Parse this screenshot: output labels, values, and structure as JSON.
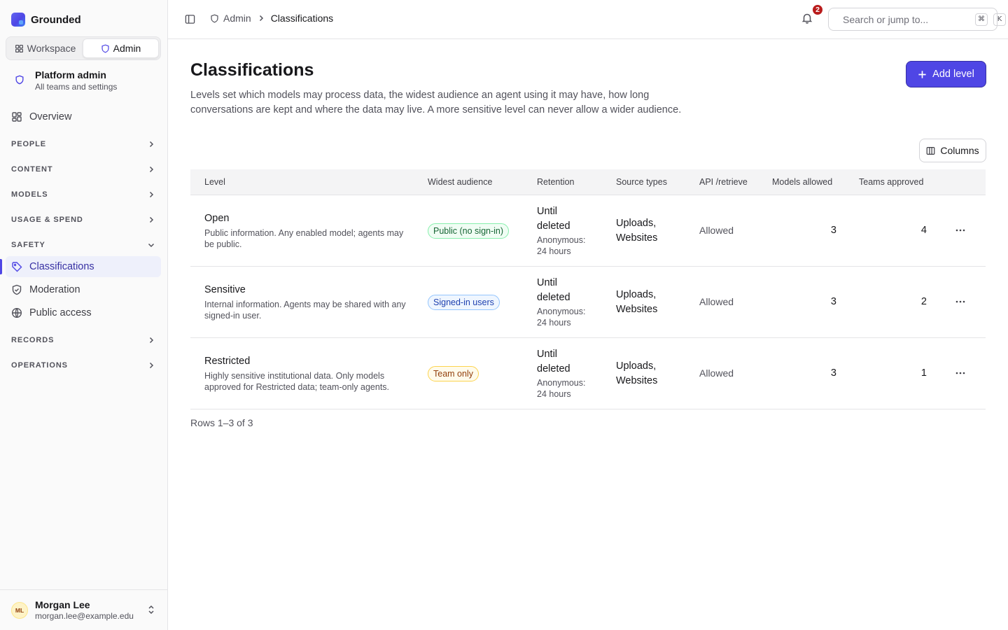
{
  "brand": {
    "name": "Grounded"
  },
  "switcher": {
    "workspace": "Workspace",
    "admin": "Admin"
  },
  "context": {
    "title": "Platform admin",
    "subtitle": "All teams and settings"
  },
  "nav": {
    "overview": "Overview",
    "people": "PEOPLE",
    "content": "CONTENT",
    "models": "MODELS",
    "usage": "USAGE & SPEND",
    "safety": "SAFETY",
    "classifications": "Classifications",
    "moderation": "Moderation",
    "public_access": "Public access",
    "records": "RECORDS",
    "operations": "OPERATIONS"
  },
  "user": {
    "initials": "ML",
    "name": "Morgan Lee",
    "email": "morgan.lee@example.edu"
  },
  "topbar": {
    "crumb_admin": "Admin",
    "crumb_current": "Classifications",
    "notifications": "2",
    "search_placeholder": "Search or jump to...",
    "kbd_cmd": "⌘",
    "kbd_k": "K"
  },
  "page": {
    "title": "Classifications",
    "description": "Levels set which models may process data, the widest audience an agent using it may have, how long conversations are kept and where the data may live. A more sensitive level can never allow a wider audience.",
    "add_label": "Add level",
    "columns_label": "Columns",
    "rows_count": "Rows 1–3 of 3"
  },
  "table": {
    "headers": {
      "level": "Level",
      "audience": "Widest audience",
      "retention": "Retention",
      "source": "Source types",
      "api": "API /retrieve",
      "models": "Models allowed",
      "teams": "Teams approved"
    },
    "rows": [
      {
        "name": "Open",
        "desc": "Public information. Any enabled model; agents may be public.",
        "audience": "Public (no sign-in)",
        "retention": "Until deleted",
        "retention_sub": "Anonymous: 24 hours",
        "source": "Uploads, Websites",
        "api": "Allowed",
        "models": "3",
        "teams": "4"
      },
      {
        "name": "Sensitive",
        "desc": "Internal information. Agents may be shared with any signed-in user.",
        "audience": "Signed-in users",
        "retention": "Until deleted",
        "retention_sub": "Anonymous: 24 hours",
        "source": "Uploads, Websites",
        "api": "Allowed",
        "models": "3",
        "teams": "2"
      },
      {
        "name": "Restricted",
        "desc": "Highly sensitive institutional data. Only models approved for Restricted data; team-only agents.",
        "audience": "Team only",
        "retention": "Until deleted",
        "retention_sub": "Anonymous: 24 hours",
        "source": "Uploads, Websites",
        "api": "Allowed",
        "models": "3",
        "teams": "1"
      }
    ]
  },
  "colors": {
    "accent": "#4f46e5",
    "badge": "#b91c1c"
  }
}
